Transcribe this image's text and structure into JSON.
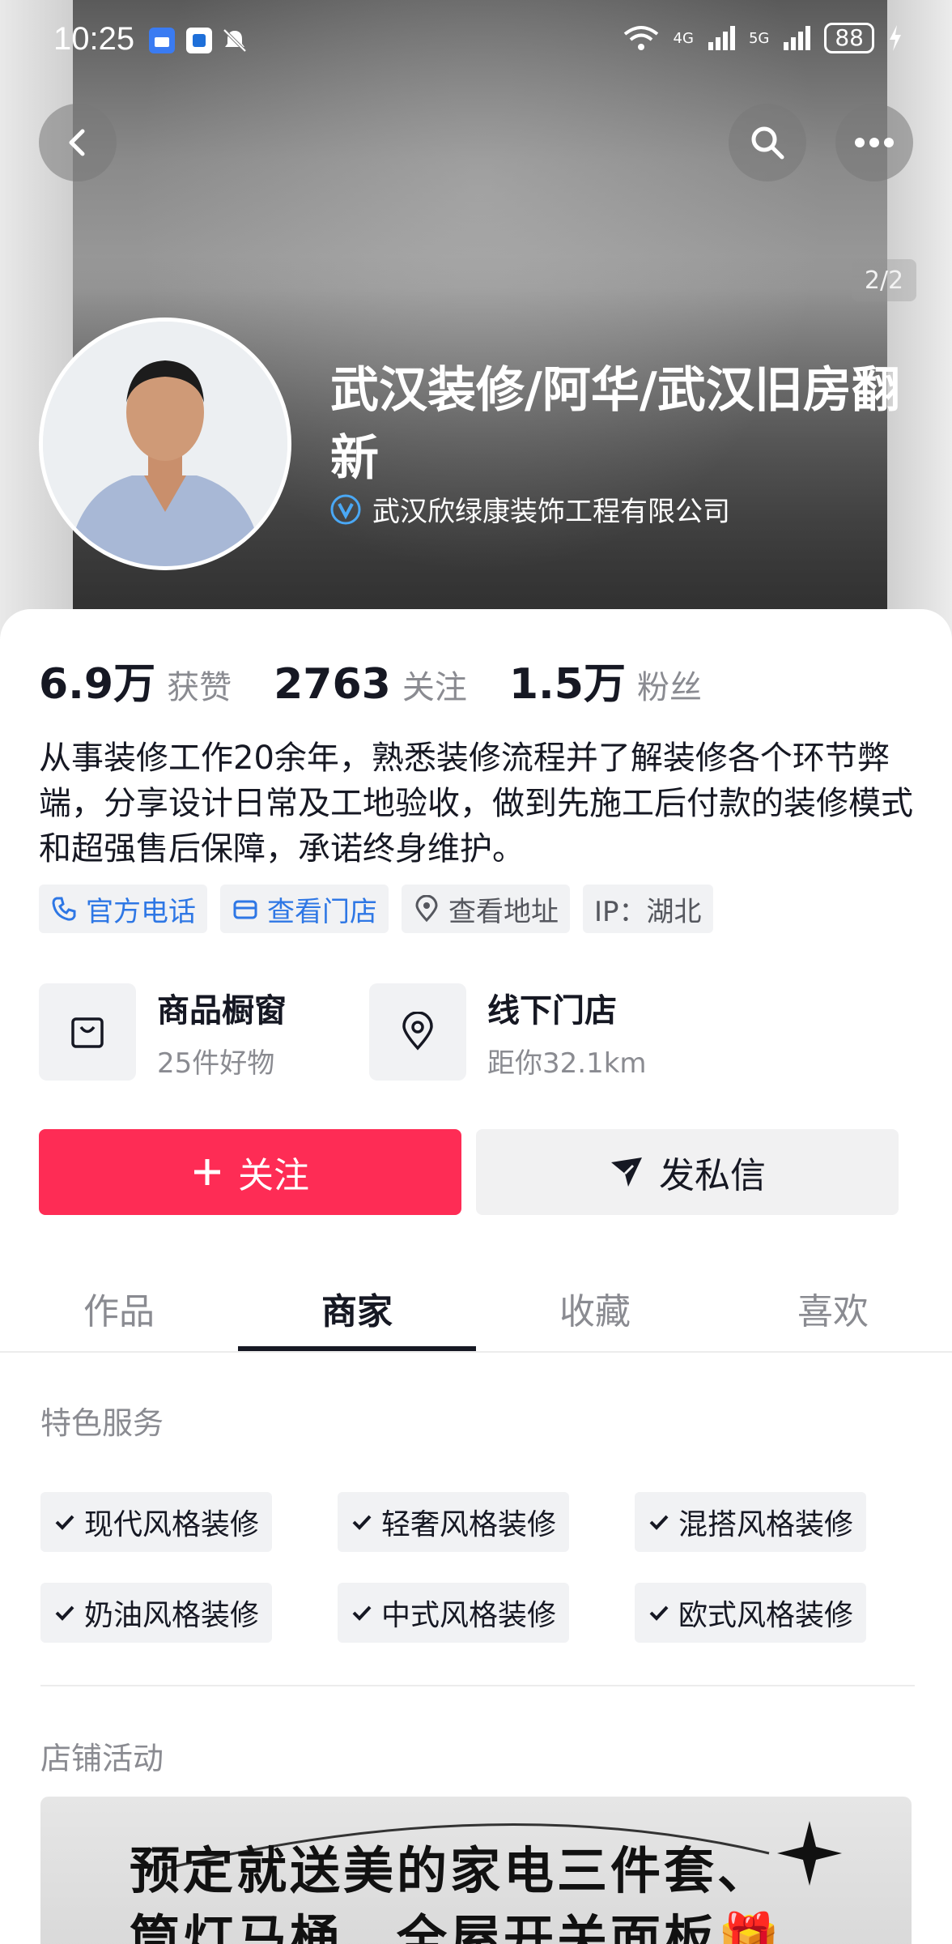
{
  "status_bar": {
    "time": "10:25",
    "battery": "88",
    "net1": "4G",
    "net2": "5G"
  },
  "header": {
    "page_indicator": "2/2"
  },
  "profile": {
    "name": "武汉装修/阿华/武汉旧房翻新",
    "company": "武汉欣绿康装饰工程有限公司"
  },
  "stats": [
    {
      "num": "6.9万",
      "label": "获赞"
    },
    {
      "num": "2763",
      "label": "关注"
    },
    {
      "num": "1.5万",
      "label": "粉丝"
    }
  ],
  "bio": "从事装修工作20余年，熟悉装修流程并了解装修各个环节弊端，分享设计日常及工地验收，做到先施工后付款的装修模式和超强售后保障，承诺终身维护。",
  "tags": [
    "官方电话",
    "查看门店",
    "查看地址",
    "IP：湖北"
  ],
  "features": [
    {
      "title": "商品橱窗",
      "sub": "25件好物"
    },
    {
      "title": "线下门店",
      "sub": "距你32.1km"
    }
  ],
  "actions": {
    "follow": "关注",
    "message": "发私信"
  },
  "tabs": [
    "作品",
    "商家",
    "收藏",
    "喜欢"
  ],
  "services": {
    "title": "特色服务",
    "items": [
      "现代风格装修",
      "轻奢风格装修",
      "混搭风格装修",
      "奶油风格装修",
      "中式风格装修",
      "欧式风格装修"
    ]
  },
  "activities": {
    "title": "店铺活动",
    "banner_line1": "预定就送美的家电三件套、",
    "banner_line2": "筒灯马桶、全屋开关面板🎁"
  },
  "colors": {
    "accent": "#fe2c55",
    "link": "#2e77e5"
  }
}
